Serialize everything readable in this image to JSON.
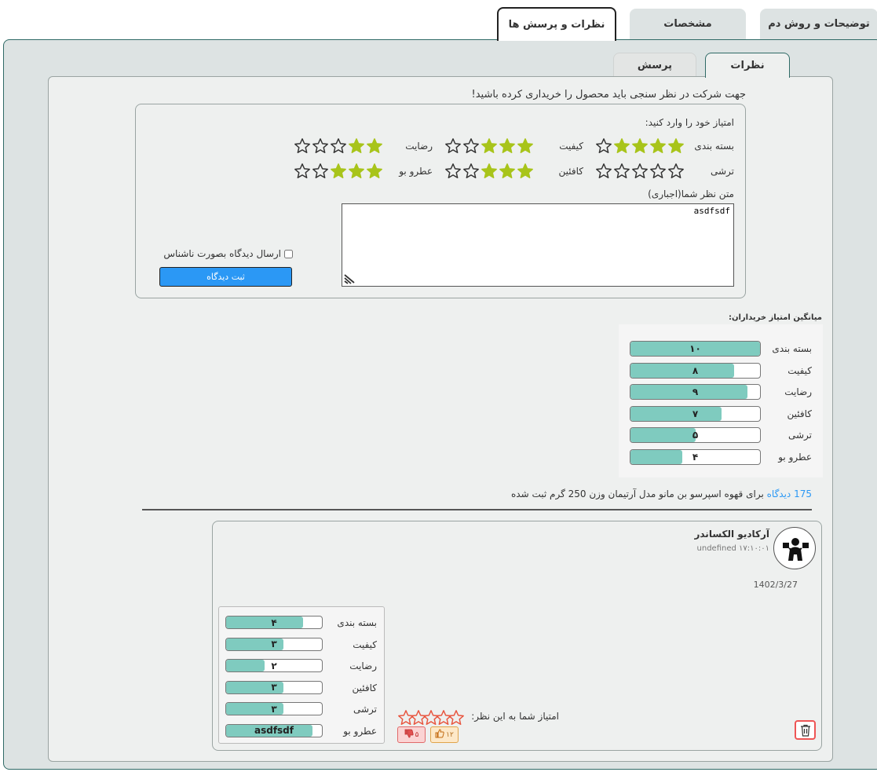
{
  "tabs": {
    "description": "توضیحات و روش دم",
    "specs": "مشخصات",
    "reviews": "نظرات و پرسش ها"
  },
  "subtabs": {
    "reviews": "نظرات",
    "question": "پرسش"
  },
  "form": {
    "notice": "جهت شرکت در نظر سنجی باید محصول را خریداری کرده باشید!",
    "prompt": "امتیاز خود را وارد کنید:",
    "criteria": [
      {
        "label": "بسته بندی",
        "rating": 4
      },
      {
        "label": "کیفیت",
        "rating": 3
      },
      {
        "label": "رضایت",
        "rating": 2
      },
      {
        "label": "ترشی",
        "rating": 0
      },
      {
        "label": "کافئین",
        "rating": 3
      },
      {
        "label": "عطرو بو",
        "rating": 3
      }
    ],
    "comment_label": "متن نظر شما(اجباری)",
    "comment_value": "asdfsdf",
    "anonymous_label": "ارسال دیدگاه بصورت ناشناس",
    "submit_label": "ثبت دیدگاه"
  },
  "average": {
    "title": "میانگین امتیاز خریداران:",
    "items": [
      {
        "label": "بسته بندی",
        "value": "۱۰",
        "fraction": 1.0
      },
      {
        "label": "کیفیت",
        "value": "۸",
        "fraction": 0.8
      },
      {
        "label": "رضایت",
        "value": "۹",
        "fraction": 0.9
      },
      {
        "label": "کافئین",
        "value": "۷",
        "fraction": 0.7
      },
      {
        "label": "ترشی",
        "value": "۵",
        "fraction": 0.5
      },
      {
        "label": "عطرو بو",
        "value": "۴",
        "fraction": 0.4
      }
    ]
  },
  "summary": {
    "count_link": "175 دیدگاه",
    "text": "برای قهوه اسپرسو بن مانو مدل آرتیمان وزن 250 گرم ثبت شده"
  },
  "review": {
    "author": "آرکادیو الکساندر",
    "time": "undefined ۱۷:۱۰:۰۱",
    "date": "1402/3/27",
    "scores": [
      {
        "label": "بسته بندی",
        "value": "۴",
        "fraction": 0.8
      },
      {
        "label": "کیفیت",
        "value": "۳",
        "fraction": 0.6
      },
      {
        "label": "رضایت",
        "value": "۲",
        "fraction": 0.4
      },
      {
        "label": "کافئین",
        "value": "۳",
        "fraction": 0.6
      },
      {
        "label": "ترشی",
        "value": "۳",
        "fraction": 0.6
      },
      {
        "label": "عطرو بو",
        "value": "asdfsdf",
        "fraction": 0.9
      }
    ],
    "rate_prompt": "امتیاز شما به این نظر:",
    "like_count": "۱۲",
    "dislike_count": "۵"
  },
  "colors": {
    "star_filled": "#a8c41a",
    "bar_fill": "#7fcbbf",
    "submit_bg": "#2b98f5",
    "link": "#2b98f5",
    "rate_star": "#e8553f"
  }
}
